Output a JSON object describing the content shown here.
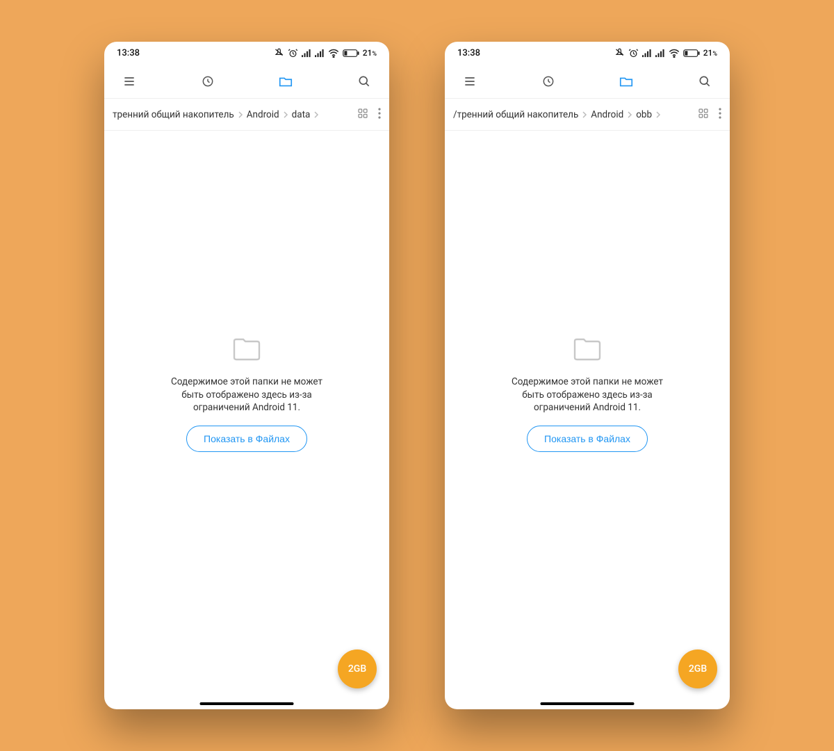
{
  "status": {
    "time": "13:38",
    "battery_pct": "21",
    "battery_suffix": "%"
  },
  "phones": [
    {
      "breadcrumb": {
        "seg1": "тренний общий накопитель",
        "seg2": "Android",
        "seg3": "data"
      },
      "empty": {
        "message": "Содержимое этой папки не может быть отображено здесь из-за ограничений Android 11.",
        "button": "Показать в Файлах"
      },
      "fab": "2GB"
    },
    {
      "breadcrumb": {
        "seg1": "/тренний общий накопитель",
        "seg2": "Android",
        "seg3": "obb"
      },
      "empty": {
        "message": "Содержимое этой папки не может быть отображено здесь из-за ограничений Android 11.",
        "button": "Показать в Файлах"
      },
      "fab": "2GB"
    }
  ]
}
